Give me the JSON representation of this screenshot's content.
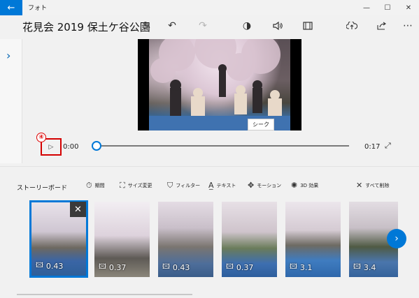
{
  "titlebar": {
    "back_icon": "←",
    "app_name": "フォト",
    "minimize_icon": "—",
    "maximize_icon": "☐",
    "close_icon": "✕"
  },
  "toolbar": {
    "project_title": "花見会 2019 保土ケ谷公園",
    "icons": [
      "edit-icon",
      "undo-icon",
      "redo-icon",
      "palette-icon",
      "audio-icon",
      "aspect-icon",
      "upload-icon",
      "share-icon",
      "more-icon"
    ],
    "edit_glyph": "✎",
    "undo_glyph": "↶",
    "redo_glyph": "↷",
    "palette_glyph": "◑",
    "audio_glyph": "🔊",
    "aspect_glyph": "▭",
    "upload_glyph": "⇪",
    "share_glyph": "⇗",
    "more_glyph": "⋯"
  },
  "left_panel": {
    "chevron": "›"
  },
  "preview": {
    "seek_tooltip": "シーク"
  },
  "playback": {
    "callout_number": "④",
    "play_icon": "▷",
    "current_time": "0:00",
    "end_time": "0:17",
    "position_fraction": 0.0,
    "fullscreen_icon": "⤢"
  },
  "storyboard": {
    "label": "ストーリーボード",
    "tools": [
      {
        "icon": "clock-icon",
        "glyph": "⏱",
        "label": "期間"
      },
      {
        "icon": "resize-icon",
        "glyph": "⛶",
        "label": "サイズ変更"
      },
      {
        "icon": "filter-icon",
        "glyph": "⛉",
        "label": "フィルター"
      },
      {
        "icon": "text-icon",
        "glyph": "A̲",
        "label": "テキスト"
      },
      {
        "icon": "motion-icon",
        "glyph": "✥",
        "label": "モーション"
      },
      {
        "icon": "3d-effects-icon",
        "glyph": "✺",
        "label": "3D 効果"
      },
      {
        "icon": "delete-all-icon",
        "glyph": "✕",
        "label": "すべて削除"
      }
    ],
    "clips": [
      {
        "duration": "0.43",
        "selected": true
      },
      {
        "duration": "0.37",
        "selected": false
      },
      {
        "duration": "0.43",
        "selected": false
      },
      {
        "duration": "0.37",
        "selected": false
      },
      {
        "duration": "3.1",
        "selected": false
      },
      {
        "duration": "3.4",
        "selected": false
      }
    ],
    "clip_icon": "🖾",
    "clip_close_icon": "✕",
    "next_icon": "›"
  },
  "colors": {
    "accent": "#0078d7",
    "callout": "#d40000"
  }
}
